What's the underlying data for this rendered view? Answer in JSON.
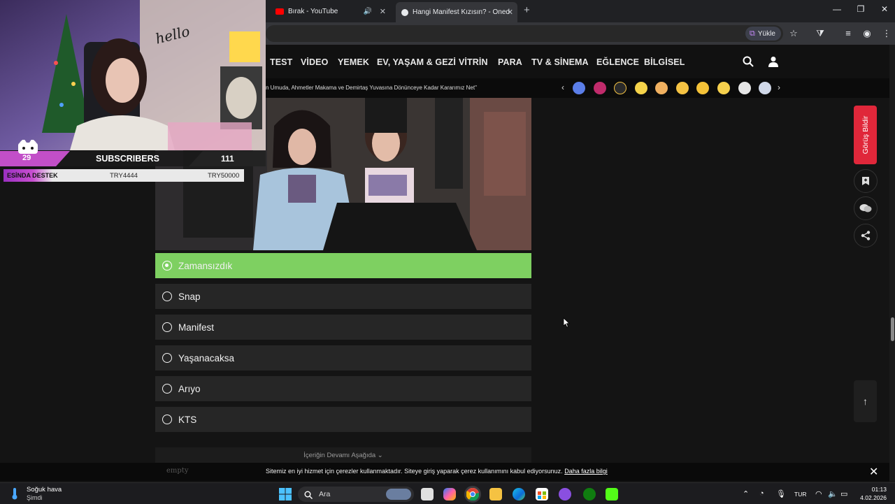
{
  "browser": {
    "tabs": [
      {
        "title": "Bırak - YouTube",
        "favicon_color": "#ff0000"
      },
      {
        "title": "Hangi Manifest Kızısın? - Oned",
        "favicon_color": "#e8eaed"
      }
    ],
    "install_label": "Yükle",
    "accent": "#3c3f4a"
  },
  "site": {
    "nav": [
      "TEST",
      "VİDEO",
      "YEMEK",
      "EV, YAŞAM & GEZİ",
      "VİTRİN",
      "PARA",
      "TV & SİNEMA",
      "EĞLENCE",
      "BİLGİSEL"
    ],
    "ticker": "n Umuda, Ahmetler Makama ve Demirtaş Yuvasına Dönünceye Kadar Kararımız Net\"",
    "ticker_prev": "‹",
    "ticker_next": "›"
  },
  "quiz": {
    "options": [
      {
        "label": "Zamansızdık",
        "selected": true
      },
      {
        "label": "Snap",
        "selected": false
      },
      {
        "label": "Manifest",
        "selected": false
      },
      {
        "label": "Yaşanacaksa",
        "selected": false
      },
      {
        "label": "Arıyo",
        "selected": false
      },
      {
        "label": "KTS",
        "selected": false
      }
    ],
    "continue_label": "İçeriğin Devamı Aşağıda ⌄",
    "selected_color": "#7ed061"
  },
  "sidebar": {
    "feedback_label": "Görüş Bildir",
    "feedback_color": "#e0273a",
    "scroll_top": "↑"
  },
  "cookie": {
    "text": "Sitemiz en iyi hizmet için çerezler kullanmaktadır. Siteye giriş yaparak çerez kullanımını kabul ediyorsunuz.",
    "link": "Daha fazla bilgi",
    "empty_label": "empty",
    "close": "✕"
  },
  "stream_overlay": {
    "hello_sign": "hello",
    "sub_count_left": "29",
    "sub_title": "SUBSCRIBERS",
    "sub_count_right": "111",
    "donate_title": "ESİNDA DESTEK",
    "donate_mid": "TRY4444",
    "donate_right": "TRY50000"
  },
  "taskbar": {
    "weather_title": "Soğuk hava",
    "weather_sub": "Şimdi",
    "search_label": "Ara",
    "lang": "TUR",
    "time": "01:13",
    "date": "4.02.2026"
  }
}
